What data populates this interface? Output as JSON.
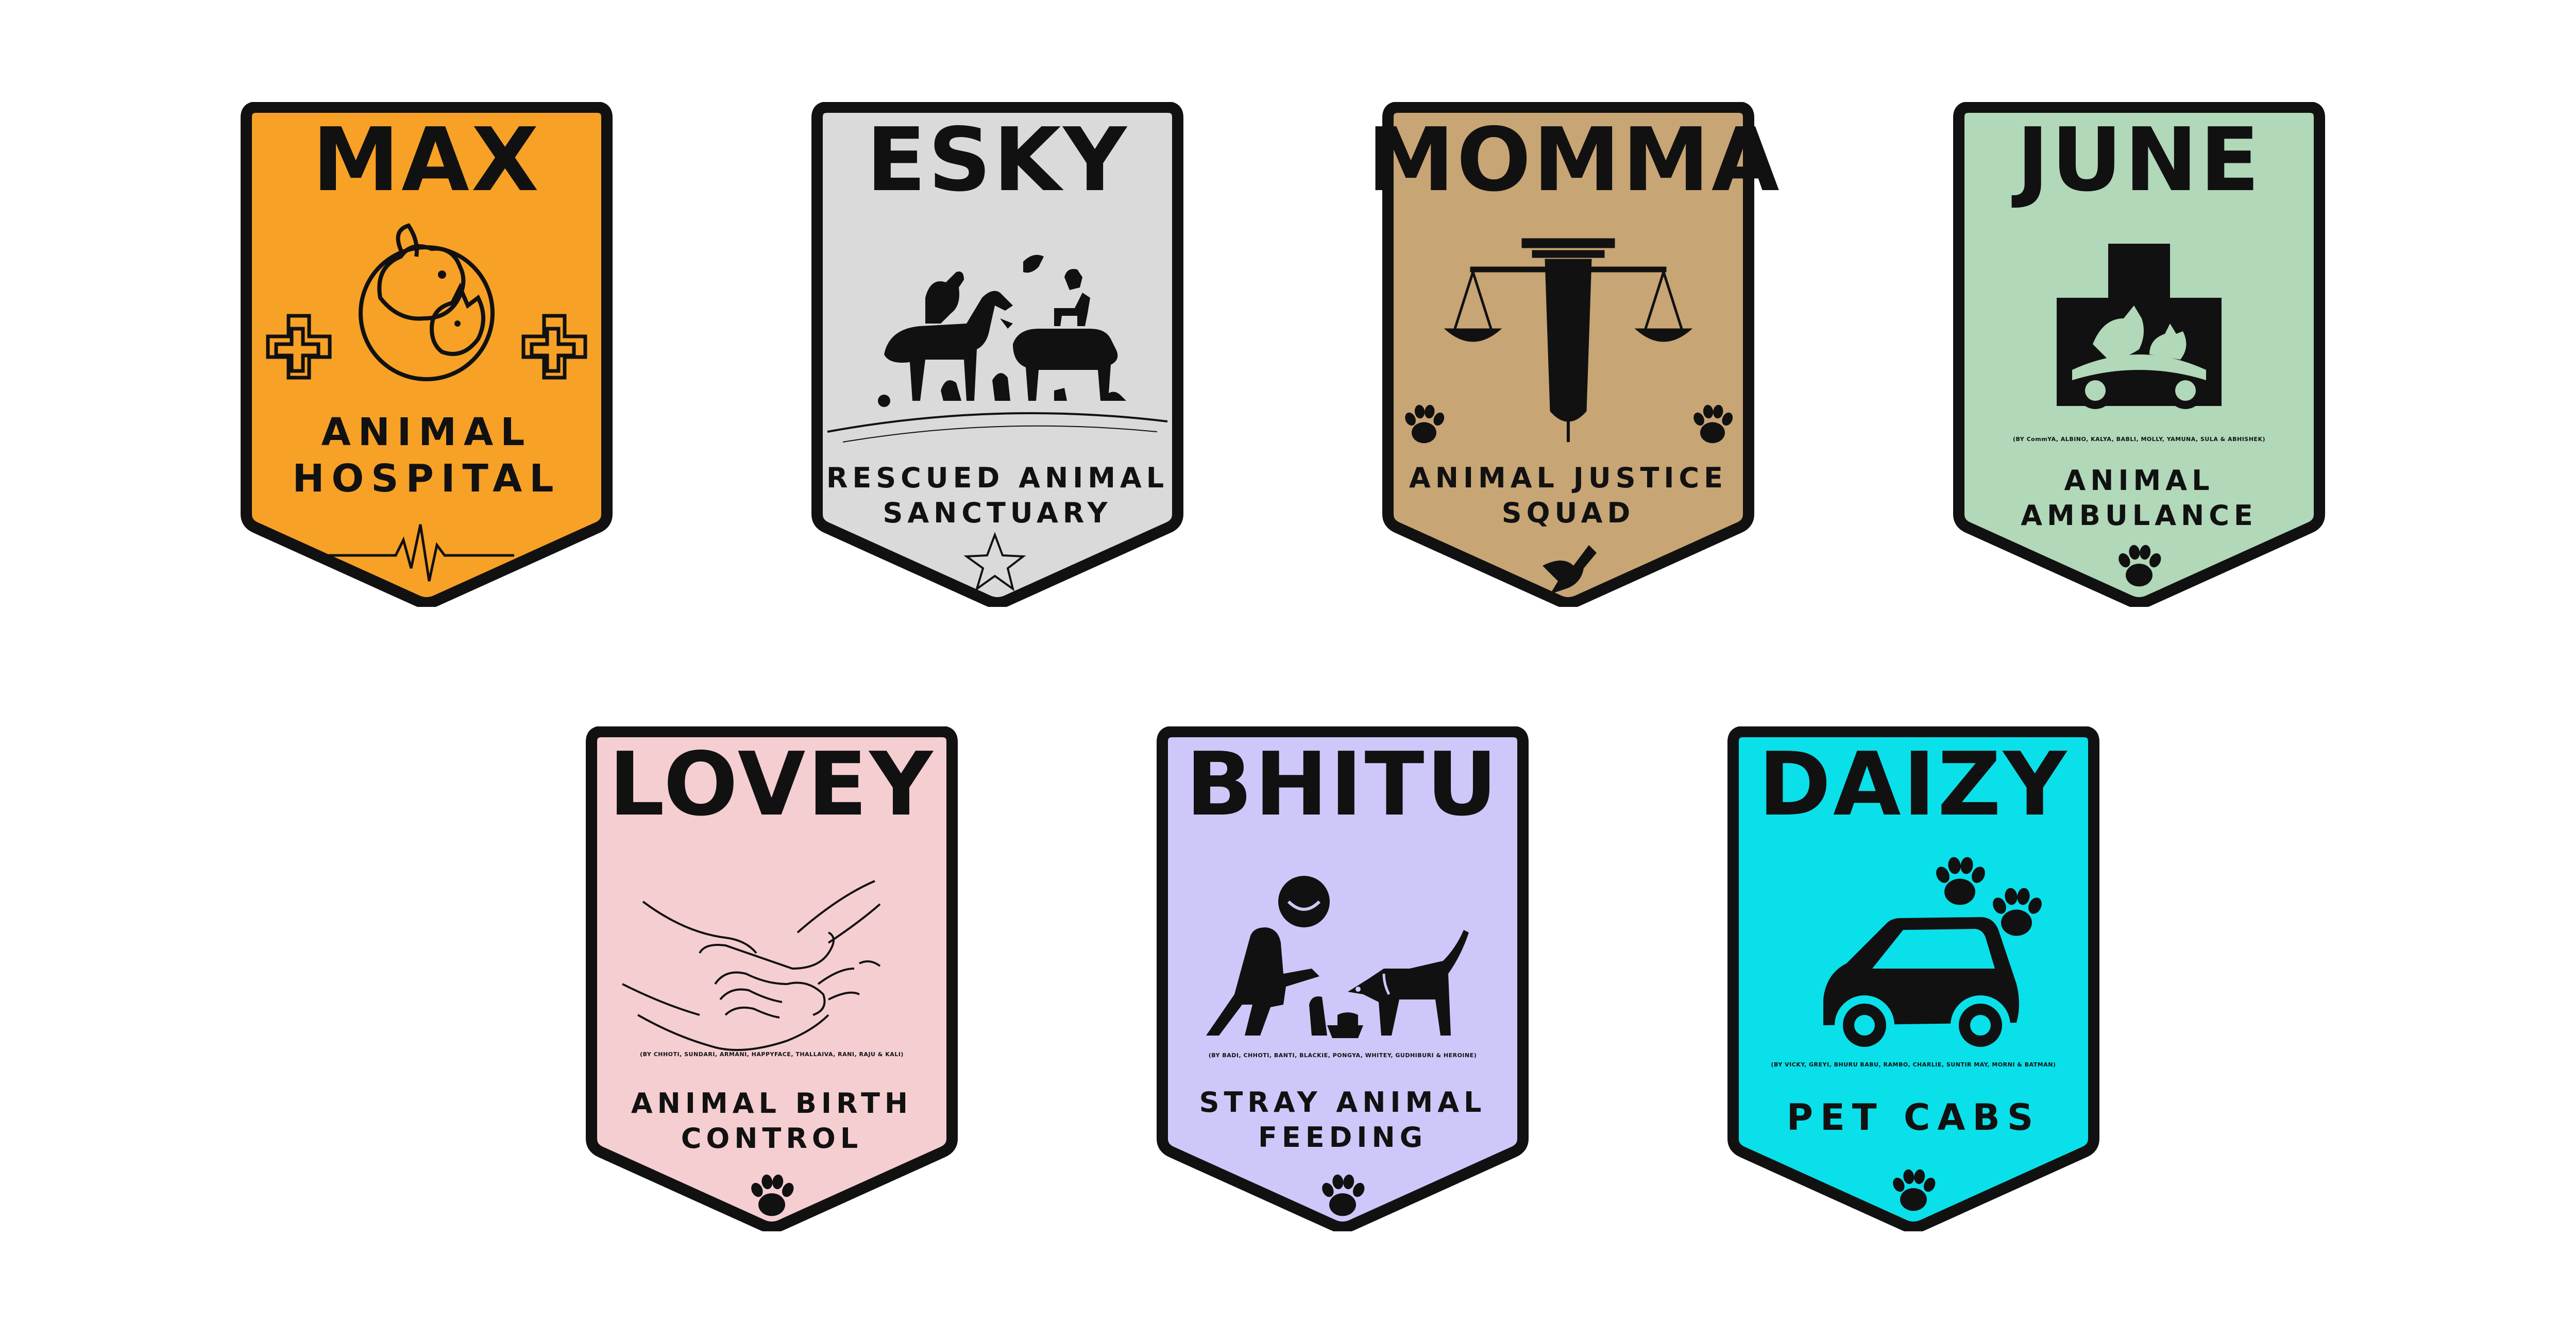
{
  "badges": [
    {
      "name": "MAX",
      "role": "ANIMAL HOSPITAL",
      "role_line1": "ANIMAL",
      "role_line2": "HOSPITAL",
      "color": "#F7A126",
      "icons": [
        "dog-cat-circle-icon",
        "medical-cross-icon",
        "heartbeat-line-icon"
      ]
    },
    {
      "name": "ESKY",
      "role": "RESCUED ANIMAL SANCTUARY",
      "role_line1": "RESCUED ANIMAL",
      "role_line2": "SANCTUARY",
      "color": "#DADADA",
      "icons": [
        "animal-group-icon",
        "star-icon"
      ]
    },
    {
      "name": "MOMMA",
      "role": "ANIMAL JUSTICE SQUAD",
      "role_line1": "ANIMAL JUSTICE",
      "role_line2": "SQUAD",
      "color": "#C8A574",
      "icons": [
        "scales-pen-icon",
        "paw-icon",
        "dove-icon"
      ]
    },
    {
      "name": "JUNE",
      "role": "ANIMAL AMBULANCE",
      "role_line1": "ANIMAL",
      "role_line2": "AMBULANCE",
      "color": "#B1D8B8",
      "credit": "(BY CommYA, ALBINO, KALYA, BABLI, MOLLY, YAMUNA, SULA & ABHISHEK)",
      "icons": [
        "ambulance-cross-icon",
        "paw-icon"
      ]
    },
    {
      "name": "LOVEY",
      "role": "ANIMAL BIRTH CONTROL",
      "role_line1": "ANIMAL BIRTH",
      "role_line2": "CONTROL",
      "color": "#F5CED2",
      "credit": "(BY CHHOTI, SUNDARI, ARMANI, HAPPYFACE, THALLAIVA, RANI, RAJU & KALI)",
      "icons": [
        "hand-paw-icon",
        "paw-icon"
      ]
    },
    {
      "name": "BHITU",
      "role": "STRAY ANIMAL FEEDING",
      "role_line1": "STRAY ANIMAL",
      "role_line2": "FEEDING",
      "color": "#CEC8FA",
      "credit": "(BY BADI, CHHOTI, BANTI, BLACKIE, PONGYA, WHITEY, GUDHIBURI & HEROINE)",
      "icons": [
        "person-feeding-dog-icon",
        "paw-icon"
      ]
    },
    {
      "name": "DAIZY",
      "role": "PET CABS",
      "role_line1": "PET CABS",
      "role_line2": "",
      "color": "#0AE0EA",
      "credit": "(BY VICKY, GREYI, BHURU BABU, RAMBO, CHARLIE, SUNTIR MAY, MORNI & BATMAN)",
      "icons": [
        "paw-icon",
        "car-icon"
      ]
    }
  ]
}
